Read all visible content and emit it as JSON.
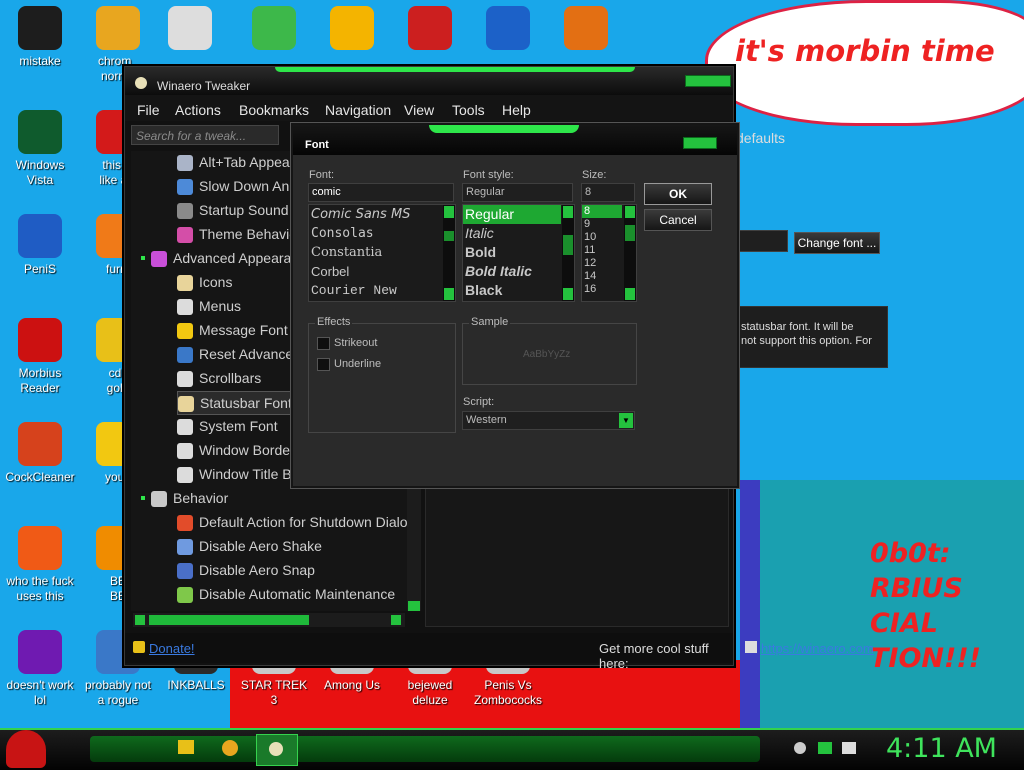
{
  "desktop": {
    "cloud_text": "it's morbin time",
    "big_text": [
      "0b0t:",
      "RBIUS",
      "CIAL",
      "TION!!!"
    ],
    "icons": [
      {
        "label": "mistake",
        "icon": "dark-circle-icon",
        "color": "#1d1d1d"
      },
      {
        "label": "chrom_\nnorma",
        "icon": "chrome-icon",
        "color": "#e8a61f"
      },
      {
        "label": "",
        "icon": "cards-icon",
        "color": "#dddddd"
      },
      {
        "label": "",
        "icon": "shield-icon",
        "color": "#3db84a"
      },
      {
        "label": "",
        "icon": "pig-icon",
        "color": "#f4b400"
      },
      {
        "label": "",
        "icon": "devcpp-icon",
        "color": "#cc1f1f"
      },
      {
        "label": "",
        "icon": "number-two-icon",
        "color": "#1c61c8"
      },
      {
        "label": "",
        "icon": "number-z-icon",
        "color": "#e36f13"
      },
      {
        "label": "Windows\nVista",
        "icon": "recycle-icon",
        "color": "#0f5b2d"
      },
      {
        "label": "this lo\nlike a v",
        "icon": "opera-icon",
        "color": "#d31a1a"
      },
      {
        "label": "PeniS",
        "icon": "photoshop-icon",
        "color": "#1f5cc4"
      },
      {
        "label": "furry",
        "icon": "firefox-icon",
        "color": "#f07a18"
      },
      {
        "label": "Morbius\nReader",
        "icon": "pdf-icon",
        "color": "#cc1111"
      },
      {
        "label": "cd l\ngold",
        "icon": "cd-icon",
        "color": "#e8c018"
      },
      {
        "label": "CockCleaner",
        "icon": "ccleaner-icon",
        "color": "#d6421c"
      },
      {
        "label": "you t",
        "icon": "star-icon",
        "color": "#f2c811"
      },
      {
        "label": "who the fuck\nuses this",
        "icon": "lightning-icon",
        "color": "#f05a16"
      },
      {
        "label": "BE\nBE",
        "icon": "vlc-icon",
        "color": "#f08c00"
      },
      {
        "label": "doesn't work\nlol",
        "icon": "yahoo-icon",
        "color": "#6f1ab1"
      },
      {
        "label": "probably not\na rogue",
        "icon": "computer-icon",
        "color": "#3a78c8"
      },
      {
        "label": "INKBALLS",
        "icon": "inkball-icon",
        "color": "#2b2b2b"
      },
      {
        "label": "STAR TREK\n3",
        "icon": "startrek-icon",
        "color": "#c8c8c8"
      },
      {
        "label": "Among Us",
        "icon": "amongus-icon",
        "color": "#c8c8c8"
      },
      {
        "label": "bejewed\ndeluze",
        "icon": "bejeweled-icon",
        "color": "#c8c8c8"
      },
      {
        "label": "Penis Vs\nZombococks",
        "icon": "pvz-icon",
        "color": "#c8c8c8"
      }
    ]
  },
  "window": {
    "title": "Winaero Tweaker",
    "menu": [
      "File",
      "Actions",
      "Bookmarks",
      "Navigation",
      "View",
      "Tools",
      "Help"
    ],
    "search_placeholder": "Search for a tweak...",
    "tree": [
      {
        "label": "Alt+Tab Appeara",
        "indent": 2,
        "icon_color": "#aab4c8"
      },
      {
        "label": "Slow Down Anim",
        "indent": 2,
        "icon_color": "#4d8ad8"
      },
      {
        "label": "Startup Sound",
        "indent": 2,
        "icon_color": "#8a8a8a"
      },
      {
        "label": "Theme Behavio",
        "indent": 2,
        "icon_color": "#d44ea8"
      },
      {
        "label": "Advanced Appeara",
        "indent": 1,
        "icon_color": "#c84fd8"
      },
      {
        "label": "Icons",
        "indent": 2,
        "icon_color": "#e8d49a"
      },
      {
        "label": "Menus",
        "indent": 2,
        "icon_color": "#dcdcdc"
      },
      {
        "label": "Message Font",
        "indent": 2,
        "icon_color": "#f2c811"
      },
      {
        "label": "Reset Advance",
        "indent": 2,
        "icon_color": "#3a78c8"
      },
      {
        "label": "Scrollbars",
        "indent": 2,
        "icon_color": "#dcdcdc"
      },
      {
        "label": "Statusbar Font",
        "indent": 2,
        "icon_color": "#e8d49a",
        "selected": true
      },
      {
        "label": "System Font",
        "indent": 2,
        "icon_color": "#dcdcdc"
      },
      {
        "label": "Window Borde",
        "indent": 2,
        "icon_color": "#dcdcdc"
      },
      {
        "label": "Window Title B",
        "indent": 2,
        "icon_color": "#dcdcdc"
      },
      {
        "label": "Behavior",
        "indent": 1,
        "icon_color": "#c8c8c8"
      },
      {
        "label": "Default Action for Shutdown Dialog",
        "indent": 2,
        "icon_color": "#e24c2a"
      },
      {
        "label": "Disable Aero Shake",
        "indent": 2,
        "icon_color": "#6f9ae0"
      },
      {
        "label": "Disable Aero Snap",
        "indent": 2,
        "icon_color": "#4a6fc8"
      },
      {
        "label": "Disable Automatic Maintenance",
        "indent": 2,
        "icon_color": "#7fc84a"
      }
    ],
    "right": {
      "reset_defaults": "defaults",
      "change_font": "Change font ...",
      "desc_line1": "statusbar font. It will be",
      "desc_line2": "not support this option. For"
    },
    "statusbar": {
      "donate": "Donate!",
      "more": "Get more cool stuff here:",
      "link": "https://winaero.com"
    }
  },
  "dialog": {
    "title": "Font",
    "font_label": "Font:",
    "font_value": "comic",
    "fonts": [
      "Comic Sans MS",
      "Consolas",
      "Constantia",
      "Corbel",
      "Courier New"
    ],
    "style_label": "Font style:",
    "style_value": "Regular",
    "styles": [
      "Regular",
      "Italic",
      "Bold",
      "Bold Italic",
      "Black"
    ],
    "selected_style_index": 0,
    "size_label": "Size:",
    "size_value": "8",
    "sizes": [
      "8",
      "9",
      "10",
      "11",
      "12",
      "14",
      "16"
    ],
    "selected_size_index": 0,
    "ok": "OK",
    "cancel": "Cancel",
    "effects_label": "Effects",
    "strikeout": "Strikeout",
    "underline": "Underline",
    "sample_label": "Sample",
    "sample_text": "AaBbYyZz",
    "script_label": "Script:",
    "script_value": "Western"
  },
  "taskbar": {
    "clock": "4:11 AM"
  },
  "colors": {
    "accent_green": "#2ee64a",
    "selection_green": "#1ea832",
    "desktop_blue": "#19a7ea"
  }
}
